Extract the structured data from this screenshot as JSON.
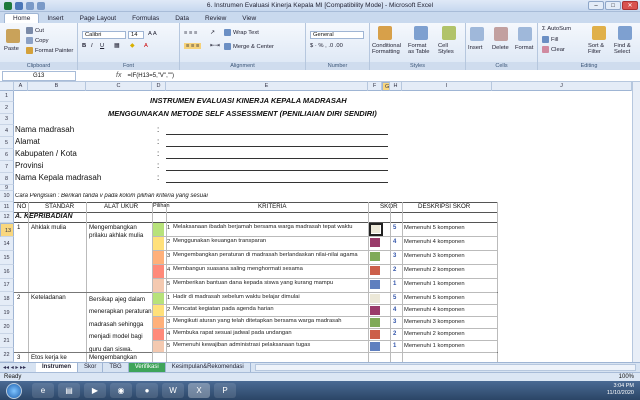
{
  "window": {
    "title": "6. Instrumen Evaluasi Kinerja Kepala MI  [Compatibility Mode] - Microsoft Excel"
  },
  "tabs": [
    "Home",
    "Insert",
    "Page Layout",
    "Formulas",
    "Data",
    "Review",
    "View"
  ],
  "ribbon": {
    "clipboard": {
      "label": "Clipboard",
      "paste": "Paste",
      "cut": "Cut",
      "copy": "Copy",
      "format_painter": "Format Painter"
    },
    "font": {
      "label": "Font",
      "name": "Calibri",
      "size": "14"
    },
    "alignment": {
      "label": "Alignment",
      "wrap": "Wrap Text",
      "merge": "Merge & Center"
    },
    "number": {
      "label": "Number",
      "format": "General"
    },
    "styles": {
      "label": "Styles",
      "cond": "Conditional Formatting",
      "table": "Format as Table",
      "cell": "Cell Styles"
    },
    "cells": {
      "label": "Cells",
      "insert": "Insert",
      "delete": "Delete",
      "format": "Format"
    },
    "editing": {
      "label": "Editing",
      "autosum": "AutoSum",
      "fill": "Fill",
      "clear": "Clear",
      "sort": "Sort & Filter",
      "find": "Find & Select"
    }
  },
  "formula_bar": {
    "name_box": "G13",
    "fx": "fx",
    "formula": "=IF(H13=5,\"V\",\"\")"
  },
  "columns": [
    "A",
    "B",
    "C",
    "D",
    "E",
    "F",
    "G",
    "H",
    "I",
    "J"
  ],
  "rows": [
    "1",
    "2",
    "3",
    "4",
    "5",
    "6",
    "7",
    "8",
    "9",
    "10",
    "11",
    "12",
    "13",
    "14",
    "15",
    "16",
    "17",
    "18",
    "19",
    "20",
    "21",
    "22",
    "23"
  ],
  "sheet": {
    "title1": "INSTRUMEN EVALUASI KINERJA KEPALA MADRASAH",
    "title2": "MENGGUNAKAN METODE SELF ASSESSMENT (PENILIAIAN DIRI SENDIRI)",
    "fields": [
      "Nama madrasah",
      "Alamat",
      "Kabupaten / Kota",
      "Provinsi",
      "Nama Kepala madrasah"
    ],
    "colon": ":",
    "instruction": "Cara Pengisian : Berikan tanda v pada kolom pilihan kriteria yang sesuai",
    "headers": {
      "no": "NO",
      "standar": "STANDAR",
      "alat": "ALAT UKUR",
      "pilihan": "Pilihan",
      "kriteria": "KRITERIA",
      "skor": "SKOR",
      "deskripsi": "DESKRIPSI SKOR"
    },
    "section": "A. KEPRIBADIAN",
    "item1": {
      "no": "1",
      "standar": "Ahklak mulia",
      "alat": "Mengembangkan prilaku akhlak mulia",
      "criteria": [
        {
          "n": "1",
          "text": "Melaksanaan ibadah berjamah bersama warga madrasah tepat waktu",
          "skor": "5",
          "desc": "Memenuhi 5 komponen"
        },
        {
          "n": "2",
          "text": "Menggunakan keuangan transparan",
          "skor": "4",
          "desc": "Memenuhi 4 komponen"
        },
        {
          "n": "3",
          "text": "Mengembangkan peraturan di madrasah berlandaskan nilai-nilai agama",
          "skor": "3",
          "desc": "Memenuhi 3 komponen"
        },
        {
          "n": "4",
          "text": "Membangun suasana saling menghormati sesama",
          "skor": "2",
          "desc": "Memenuhi 2 komponen"
        },
        {
          "n": "5",
          "text": "Memberikan bantuan dana kepada siswa yang kurang mampu",
          "skor": "1",
          "desc": "Memenuhi 1 komponen"
        }
      ]
    },
    "item2": {
      "no": "2",
      "standar": "Keteladanan",
      "alat": "Bersikap ajeg dalam menerapkan peraturan madrasah sehingga menjadi model bagi guru dan siswa.",
      "criteria": [
        {
          "n": "1",
          "text": "Hadir di madrasah sebelum waktu belajar dimulai",
          "skor": "5",
          "desc": "Memenuhi 5 komponen"
        },
        {
          "n": "2",
          "text": "Mencatat kegiatan pada agenda harian",
          "skor": "4",
          "desc": "Memenuhi 4 komponen"
        },
        {
          "n": "3",
          "text": "Mengikuti aturan yang telah ditetapkan bersama warga madrasah",
          "skor": "3",
          "desc": "Memenuhi 3 komponen"
        },
        {
          "n": "4",
          "text": "Membuka  rapat sesuai jadwal pada undangan",
          "skor": "2",
          "desc": "Memenuhi 2 komponen"
        },
        {
          "n": "5",
          "text": "Memenuhi kewajiban administrasi pelaksanaan tugas",
          "skor": "1",
          "desc": "Memenuhi 1 komponen"
        }
      ]
    },
    "item3": {
      "no": "3",
      "standar": "Etos kerja ke",
      "alat": "Mengembangkan"
    }
  },
  "sheet_tabs": [
    "Instrumen",
    "Skor",
    "TBG",
    "Verifikasi",
    "Kesimpulan&Rekomendasi"
  ],
  "status": {
    "ready": "Ready",
    "zoom": "100%"
  },
  "tray": {
    "time": "3:04 PM",
    "date": "11/10/2020"
  },
  "colors": {
    "swatches": [
      "#b7e27a",
      "#ffe07a",
      "#ffb07a",
      "#ff8a7a",
      "#f4c9b0"
    ],
    "skor_boxes": [
      "#ece8d8",
      "#9a3b6a",
      "#7faa58",
      "#cc5f4a",
      "#5f7fbf"
    ]
  }
}
